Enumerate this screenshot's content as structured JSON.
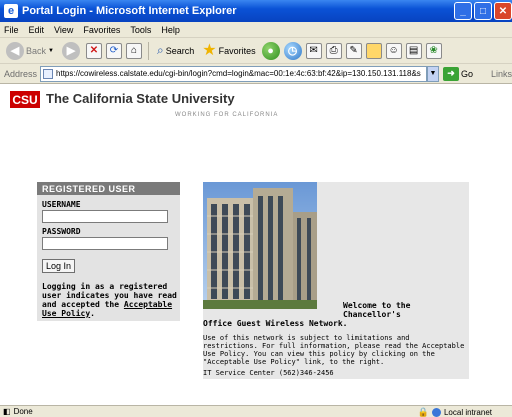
{
  "window": {
    "title": "Portal Login - Microsoft Internet Explorer"
  },
  "menu": [
    "File",
    "Edit",
    "View",
    "Favorites",
    "Tools",
    "Help"
  ],
  "toolbar": {
    "back_label": "Back",
    "search_label": "Search",
    "favorites_label": "Favorites"
  },
  "address": {
    "label": "Address",
    "url": "https://cowireless.calstate.edu/cgi-bin/login?cmd=login&mac=00:1e:4c:63:bf:42&ip=130.150.131.118&s",
    "go_label": "Go",
    "links_label": "Links"
  },
  "header": {
    "logo_text": "CSU",
    "title": "The California State University",
    "tagline": "WORKING FOR CALIFORNIA"
  },
  "login": {
    "panel_title": "REGISTERED USER",
    "username_label": "USERNAME",
    "password_label": "PASSWORD",
    "login_button": "Log In",
    "notice_text": "Logging in as a registered user indicates you have read and accepted the",
    "policy_link": "Acceptable Use Policy",
    "notice_end": "."
  },
  "info": {
    "welcome_line1": "Welcome to the Chancellor's",
    "welcome_line2": "Office Guest Wireless Network.",
    "policy_text": "Use of this network is subject to limitations and restrictions. For full information, please read the Acceptable Use Policy. You can view this policy by clicking on the \"Acceptable Use Policy\" link, to the right.",
    "it_center": "IT Service Center (562)346-2456"
  },
  "status": {
    "text": "Done",
    "zone": "Local intranet"
  }
}
